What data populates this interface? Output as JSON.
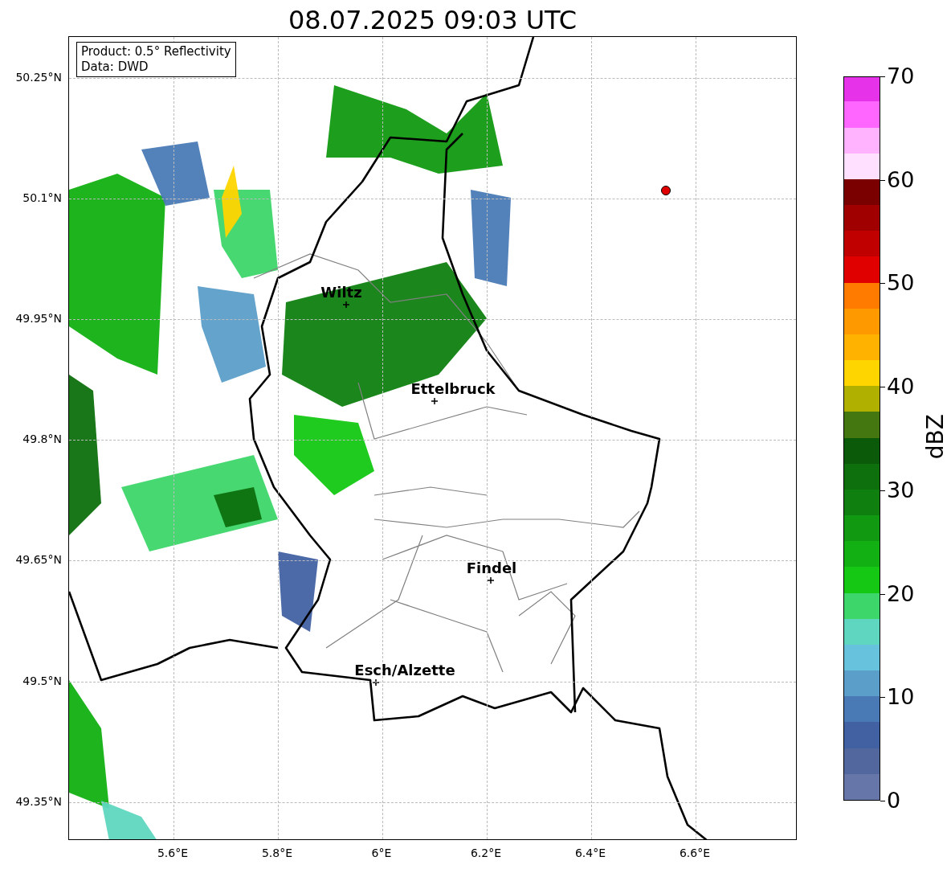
{
  "title": "08.07.2025 09:03 UTC",
  "info_box": {
    "lines": [
      "Product: 0.5° Reflectivity",
      "Data: DWD"
    ]
  },
  "map": {
    "lat_ticks": [
      "50.25°N",
      "50.1°N",
      "49.95°N",
      "49.8°N",
      "49.65°N",
      "49.5°N",
      "49.35°N"
    ],
    "lon_ticks": [
      "5.6°E",
      "5.8°E",
      "6°E",
      "6.2°E",
      "6.4°E",
      "6.6°E"
    ],
    "cities": [
      "Wiltz",
      "Ettelbruck",
      "Findel",
      "Esch/Alzette"
    ]
  },
  "colorbar": {
    "label": "dBZ",
    "ticks": [
      "70",
      "60",
      "50",
      "40",
      "30",
      "20",
      "10",
      "0"
    ],
    "segments": [
      {
        "color": "#6676a8"
      },
      {
        "color": "#52679e"
      },
      {
        "color": "#4261a3"
      },
      {
        "color": "#4a7ab5"
      },
      {
        "color": "#5b9ec9"
      },
      {
        "color": "#66c2dd"
      },
      {
        "color": "#5fd7c0"
      },
      {
        "color": "#3dd66a"
      },
      {
        "color": "#14c814"
      },
      {
        "color": "#12b012"
      },
      {
        "color": "#119911"
      },
      {
        "color": "#0f800f"
      },
      {
        "color": "#0d700d"
      },
      {
        "color": "#0a5a0a"
      },
      {
        "color": "#447710"
      },
      {
        "color": "#b0b000"
      },
      {
        "color": "#ffd500"
      },
      {
        "color": "#ffb300"
      },
      {
        "color": "#ff9900"
      },
      {
        "color": "#ff7b00"
      },
      {
        "color": "#e00000"
      },
      {
        "color": "#c00000"
      },
      {
        "color": "#a00000"
      },
      {
        "color": "#7a0000"
      },
      {
        "color": "#ffe0ff"
      },
      {
        "color": "#ffb3ff"
      },
      {
        "color": "#ff66ff"
      },
      {
        "color": "#e633ea"
      }
    ]
  }
}
